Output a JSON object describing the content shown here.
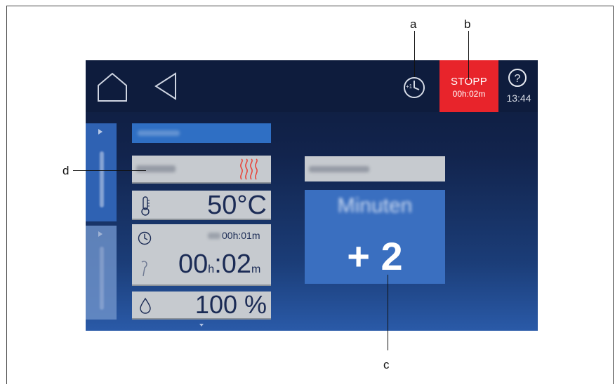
{
  "callouts": {
    "a": "a",
    "b": "b",
    "c": "c",
    "d": "d"
  },
  "header": {
    "stop_label": "STOPP",
    "stop_time": "00h:02m",
    "help_glyph": "?",
    "clock": "13:44",
    "timer_icon_text": "+1"
  },
  "cooking": {
    "temperature": "50°C",
    "timer_small": "00h:01m",
    "timer_main_h": "00",
    "timer_main_h_unit": "h",
    "timer_main_sep": ":",
    "timer_main_m": "02",
    "timer_main_m_unit": "m",
    "humidity": "100 %"
  },
  "adjust": {
    "unit": "Minuten",
    "value": "+ 2"
  },
  "colors": {
    "stop": "#e8242b",
    "accent": "#2f6fc4",
    "panel": "#c6cacf"
  }
}
